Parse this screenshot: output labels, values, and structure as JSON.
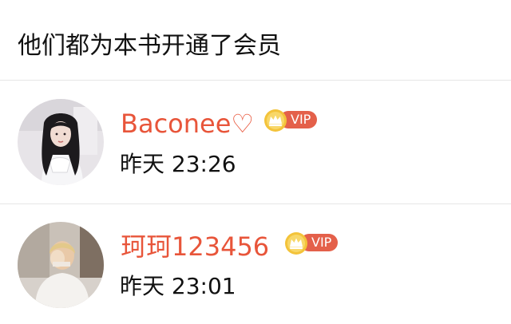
{
  "header": {
    "title": "他们都为本书开通了会员"
  },
  "theme": {
    "username_color": "#e8553a",
    "vip_badge_color": "#e4604a",
    "crown_color": "#f3c33a",
    "divider_color": "#e6e6e6"
  },
  "members": [
    {
      "name": "Baconee♡",
      "badge": "VIP",
      "time": "昨天 23:26",
      "avatar_icon": "avatar-photo"
    },
    {
      "name": "珂珂123456",
      "badge": "VIP",
      "time": "昨天 23:01",
      "avatar_icon": "avatar-photo"
    }
  ]
}
